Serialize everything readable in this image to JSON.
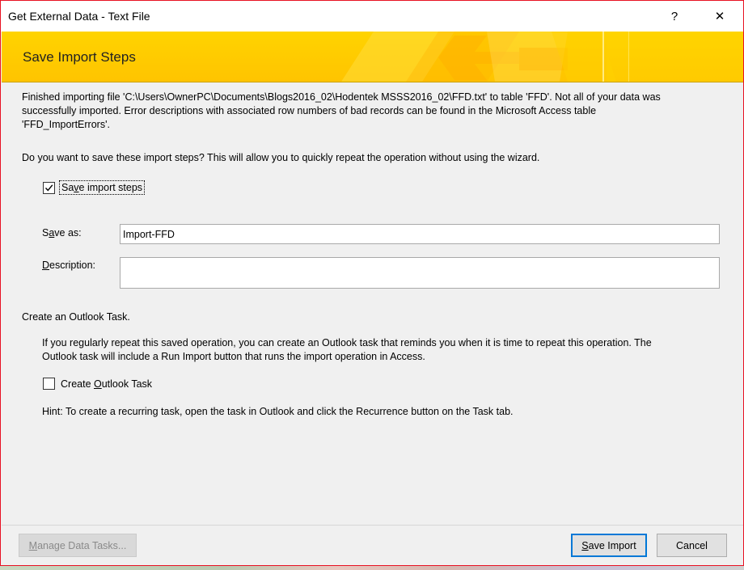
{
  "window": {
    "title": "Get External Data - Text File",
    "help_label": "?",
    "close_label": "✕"
  },
  "banner": {
    "title": "Save Import Steps"
  },
  "message": {
    "line1": "Finished importing file 'C:\\Users\\OwnerPC\\Documents\\Blogs2016_02\\Hodentek MSSS2016_02\\FFD.txt' to table 'FFD'.  Not all of your data was",
    "line2": "successfully imported. Error descriptions with associated row numbers of bad records can be found in the Microsoft Access table",
    "line3": "'FFD_ImportErrors'."
  },
  "question": "Do you want to save these import steps? This will allow you to quickly repeat the operation without using the wizard.",
  "save_steps": {
    "checked": true,
    "label_pre": "Sa",
    "label_accel": "v",
    "label_post": "e import steps"
  },
  "save_as": {
    "label_pre": "S",
    "label_accel": "a",
    "label_post": "ve as:",
    "value": "Import-FFD"
  },
  "description": {
    "label_accel": "D",
    "label_post": "escription:",
    "value": ""
  },
  "outlook": {
    "section_title": "Create an Outlook Task.",
    "info_line1": "If you regularly repeat this saved operation, you can create an Outlook task that reminds you when it is time to repeat this operation. The",
    "info_line2": "Outlook task will include a Run Import button that runs the import operation in Access.",
    "checkbox_checked": false,
    "checkbox_label_pre": "Create ",
    "checkbox_label_accel": "O",
    "checkbox_label_post": "utlook Task",
    "hint": "Hint: To create a recurring task, open the task in Outlook and click the Recurrence button on the Task tab."
  },
  "buttons": {
    "manage_accel": "M",
    "manage_post": "anage Data Tasks...",
    "save_accel": "S",
    "save_post": "ave Import",
    "cancel": "Cancel"
  }
}
